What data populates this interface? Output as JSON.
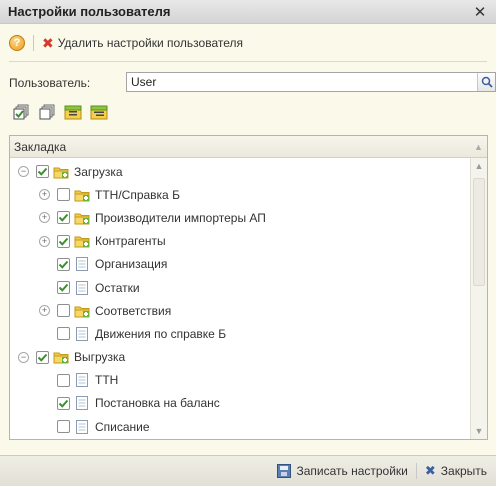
{
  "window": {
    "title": "Настройки пользователя",
    "close_glyph": "✕"
  },
  "toolbar": {
    "help_glyph": "?",
    "delete_label": "Удалить настройки пользователя"
  },
  "user_field": {
    "label": "Пользователь:",
    "value": "User"
  },
  "tree": {
    "header": "Закладка",
    "items": [
      {
        "label": "Загрузка",
        "level": 0,
        "expander": "minus",
        "checked": true,
        "icon": "folder-icon"
      },
      {
        "label": "ТТН/Справка Б",
        "level": 1,
        "expander": "plus",
        "checked": false,
        "icon": "folder-icon"
      },
      {
        "label": "Производители импортеры АП",
        "level": 1,
        "expander": "plus",
        "checked": true,
        "icon": "folder-icon"
      },
      {
        "label": "Контрагенты",
        "level": 1,
        "expander": "plus",
        "checked": true,
        "icon": "folder-icon"
      },
      {
        "label": "Организация",
        "level": 1,
        "expander": "none",
        "checked": true,
        "icon": "document-icon"
      },
      {
        "label": "Остатки",
        "level": 1,
        "expander": "none",
        "checked": true,
        "icon": "document-icon"
      },
      {
        "label": "Соответствия",
        "level": 1,
        "expander": "plus",
        "checked": false,
        "icon": "folder-icon"
      },
      {
        "label": "Движения по справке Б",
        "level": 1,
        "expander": "none",
        "checked": false,
        "icon": "document-icon"
      },
      {
        "label": "Выгрузка",
        "level": 0,
        "expander": "minus",
        "checked": true,
        "icon": "folder-icon"
      },
      {
        "label": "ТТН",
        "level": 1,
        "expander": "none",
        "checked": false,
        "icon": "document-icon"
      },
      {
        "label": "Постановка на баланс",
        "level": 1,
        "expander": "none",
        "checked": true,
        "icon": "document-icon"
      },
      {
        "label": "Списание",
        "level": 1,
        "expander": "none",
        "checked": false,
        "icon": "document-icon"
      }
    ]
  },
  "footer": {
    "save_label": "Записать настройки",
    "close_label": "Закрыть"
  },
  "colors": {
    "background": "#fbf9ea",
    "accent_red": "#d63a2a",
    "check_green": "#3a8f2e"
  }
}
